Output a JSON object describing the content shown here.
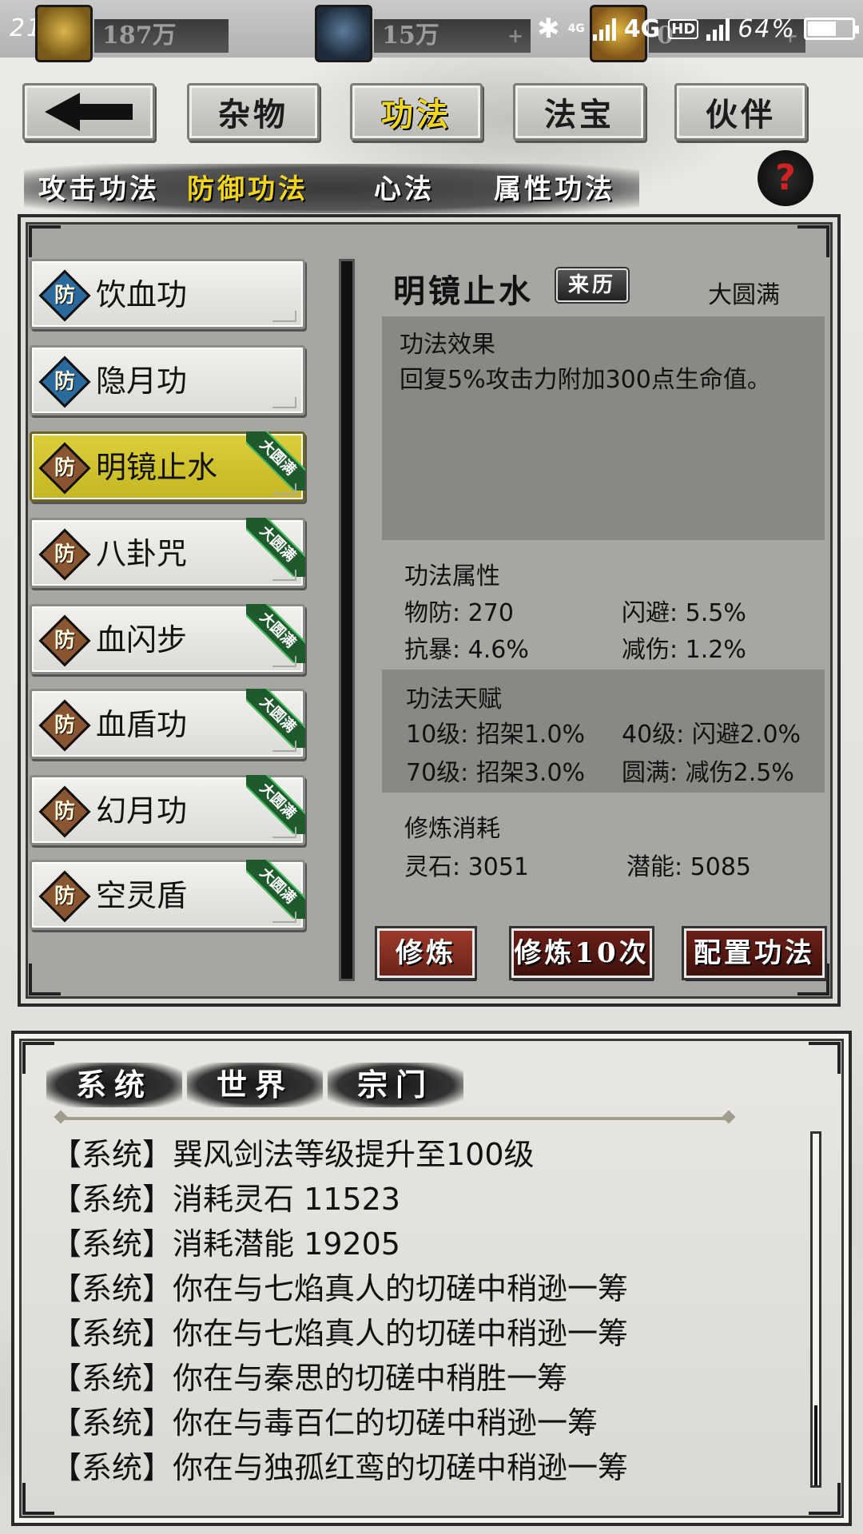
{
  "status_bar": {
    "time": "21:55",
    "resources": [
      {
        "icon": "gold-coin-icon",
        "value": "187万",
        "plus": ""
      },
      {
        "icon": "gem-icon",
        "value": "15万",
        "plus": "+"
      },
      {
        "icon": "token-icon",
        "value": "0",
        "plus": "+"
      }
    ],
    "network_small": "4G",
    "network": "4G",
    "hd": "HD",
    "battery": "64%",
    "battery_level": 0.64
  },
  "nav": {
    "back_label": "",
    "tabs": [
      "杂物",
      "功法",
      "法宝",
      "伙伴"
    ],
    "active_tab": "功法"
  },
  "sub_tabs": {
    "items": [
      "攻击功法",
      "防御功法",
      "心法",
      "属性功法"
    ],
    "active": "防御功法",
    "help": "?"
  },
  "skill_list": [
    {
      "badge": "防",
      "name": "饮血功",
      "badge_color": "#2b6a9c",
      "ribbon": ""
    },
    {
      "badge": "防",
      "name": "隐月功",
      "badge_color": "#2b6a9c",
      "ribbon": ""
    },
    {
      "badge": "防",
      "name": "明镜止水",
      "badge_color": "#8a5632",
      "ribbon": "大圆满"
    },
    {
      "badge": "防",
      "name": "八卦咒",
      "badge_color": "#8a5632",
      "ribbon": "大圆满"
    },
    {
      "badge": "防",
      "name": "血闪步",
      "badge_color": "#8a5632",
      "ribbon": "大圆满"
    },
    {
      "badge": "防",
      "name": "血盾功",
      "badge_color": "#8a5632",
      "ribbon": "大圆满"
    },
    {
      "badge": "防",
      "name": "幻月功",
      "badge_color": "#8a5632",
      "ribbon": "大圆满"
    },
    {
      "badge": "防",
      "name": "空灵盾",
      "badge_color": "#8a5632",
      "ribbon": "大圆满"
    }
  ],
  "selected_index": 2,
  "detail": {
    "title": "明镜止水",
    "origin_button": "来历",
    "level": "大圆满",
    "effect_heading": "功法效果",
    "effect_text": "回复5%攻击力附加300点生命值。",
    "attr_heading": "功法属性",
    "attrs": [
      "物防: 270",
      "闪避: 5.5%",
      "抗暴: 4.6%",
      "减伤: 1.2%"
    ],
    "talent_heading": "功法天赋",
    "talents": [
      "10级: 招架1.0%",
      "40级: 闪避2.0%",
      "70级: 招架3.0%",
      "圆满: 减伤2.5%"
    ],
    "cost_heading": "修炼消耗",
    "costs": [
      "灵石: 3051",
      "潜能: 5085"
    ],
    "buttons": {
      "train": "修炼",
      "train10": "修炼10次",
      "equip": "配置功法"
    }
  },
  "chat": {
    "tabs": [
      "系统",
      "世界",
      "宗门"
    ],
    "active_tab": "系统",
    "messages": [
      "【系统】巽风剑法等级提升至100级",
      "【系统】消耗灵石 11523",
      "【系统】消耗潜能 19205",
      "【系统】你在与七焰真人的切磋中稍逊一筹",
      "【系统】你在与七焰真人的切磋中稍逊一筹",
      "【系统】你在与秦思的切磋中稍胜一筹",
      "【系统】你在与毒百仁的切磋中稍逊一筹",
      "【系统】你在与独孤红鸾的切磋中稍逊一筹"
    ]
  },
  "colors": {
    "accent_yellow": "#f2d51c",
    "button_red": "#8a2e22",
    "ribbon_green": "#1f5a2c"
  }
}
